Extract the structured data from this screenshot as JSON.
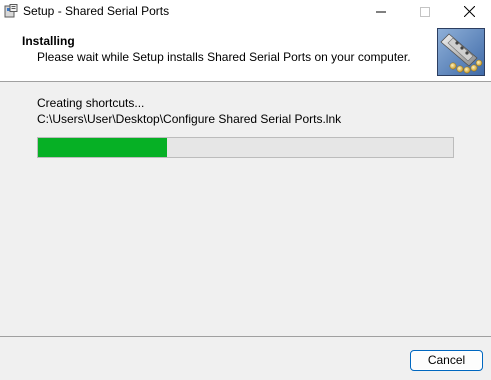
{
  "window": {
    "title": "Setup - Shared Serial Ports",
    "icon": "installer-icon",
    "controls": [
      "minimize-icon",
      "maximize-icon",
      "close-icon"
    ]
  },
  "header": {
    "title": "Installing",
    "subtitle": "Please wait while Setup installs Shared Serial Ports on your computer.",
    "image": "serial-connector-icon"
  },
  "status": {
    "label": "Creating shortcuts...",
    "path": "C:\\Users\\User\\Desktop\\Configure Shared Serial Ports.lnk"
  },
  "progress": {
    "fraction": 0.31,
    "color": "#06b025"
  },
  "footer": {
    "cancel_label": "Cancel"
  },
  "colors": {
    "accent": "#0067c0",
    "background": "#f0f0f0"
  }
}
